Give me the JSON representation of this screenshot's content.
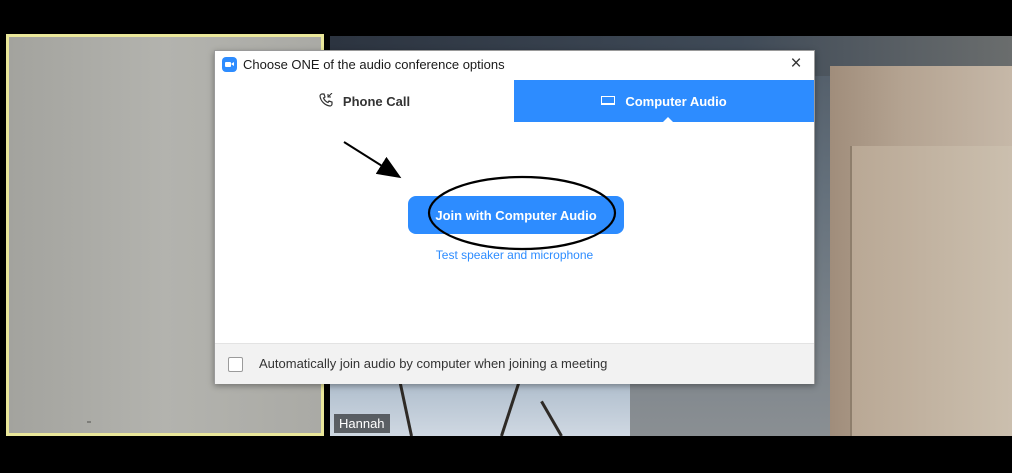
{
  "participants": [
    {
      "name": ""
    },
    {
      "name": "Hannah"
    }
  ],
  "dialog": {
    "title": "Choose ONE of the audio conference options",
    "close_glyph": "×",
    "tabs": [
      {
        "label": "Phone Call",
        "icon": "phone-icon",
        "selected": false
      },
      {
        "label": "Computer Audio",
        "icon": "laptop-icon",
        "selected": true
      }
    ],
    "join_button_label": "Join with Computer Audio",
    "test_link_label": "Test speaker and microphone",
    "footer": {
      "auto_join_label": "Automatically join audio by computer when joining a meeting",
      "auto_join_checked": false
    }
  },
  "colors": {
    "accent": "#2d8cff",
    "active_speaker_border": "#eae79a",
    "annotation": "#000000"
  }
}
